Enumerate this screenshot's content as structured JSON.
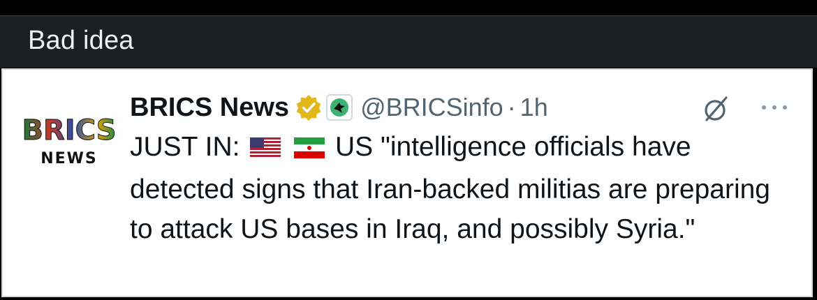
{
  "caption": {
    "text": "Bad idea"
  },
  "tweet": {
    "author_name": "BRICS News",
    "handle": "@BRICSinfo",
    "separator": "·",
    "time": "1h",
    "text_prefix": "JUST IN:",
    "text_body": "US \"intelligence officials have detected signs that Iran-backed militias are preparing to attack US bases in Iraq, and possibly Syria.\"",
    "flags": [
      "us-flag-icon",
      "iran-flag-icon"
    ],
    "logo_text_top": "BRICS",
    "logo_text_bottom": "NEWS"
  },
  "icons": {
    "verified": "verified-badge-icon",
    "affiliate": "affiliate-badge-icon",
    "grok": "grok-icon",
    "more": "more-icon"
  },
  "colors": {
    "caption_bar": "#1b1e22",
    "caption_text": "#eef0f3",
    "verified_gold": "#e2b719",
    "muted_text": "#536471",
    "main_text": "#0f1419"
  }
}
